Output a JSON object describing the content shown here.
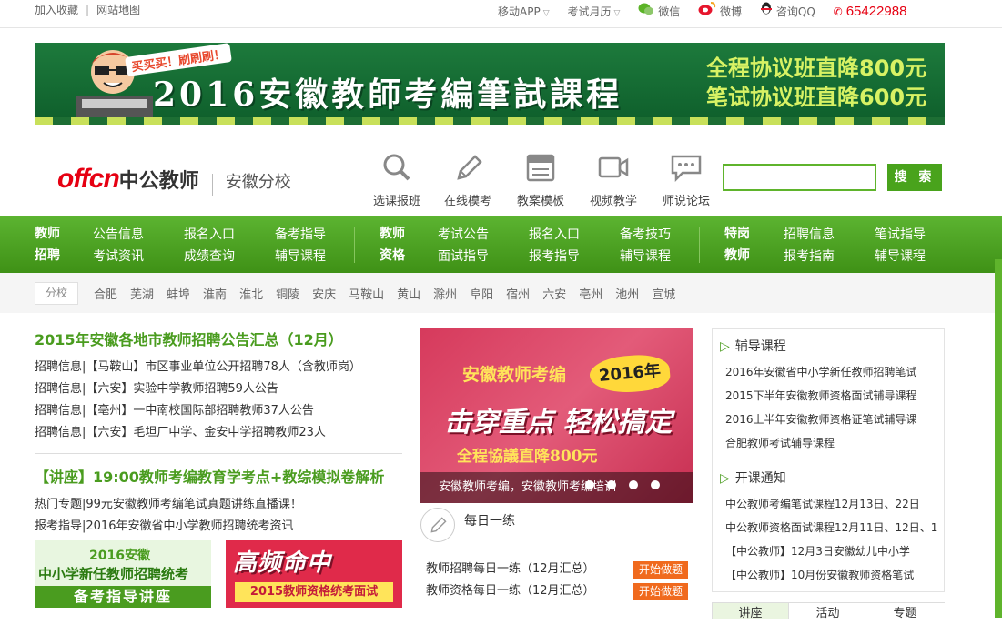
{
  "topbar": {
    "favorite": "加入收藏",
    "sitemap": "网站地图",
    "mobile_app": "移动APP",
    "exam_calendar": "考试月历",
    "wechat": "微信",
    "weibo": "微博",
    "qq": "咨询QQ",
    "phone": "65422988"
  },
  "banner": {
    "bubble": "买买买！刷刷刷！",
    "title": "2016安徽教師考編筆試課程",
    "promo_1": "全程协议班直降800元",
    "promo_2": "笔试协议班直降600元"
  },
  "brand": {
    "logo": "offcn",
    "name": "中公教师",
    "branch": "安徽分校"
  },
  "quick_links": [
    {
      "label": "选课报班",
      "icon": "search-icon"
    },
    {
      "label": "在线模考",
      "icon": "pencil-icon"
    },
    {
      "label": "教案模板",
      "icon": "calendar-icon"
    },
    {
      "label": "视频教学",
      "icon": "video-camera-icon"
    },
    {
      "label": "师说论坛",
      "icon": "chat-bubble-icon"
    }
  ],
  "search": {
    "button": "搜 索",
    "placeholder": ""
  },
  "nav": {
    "g1": {
      "title1": "教师",
      "title2": "招聘",
      "items": [
        "公告信息",
        "报名入口",
        "备考指导",
        "考试资讯",
        "成绩查询",
        "辅导课程"
      ]
    },
    "g2": {
      "title1": "教师",
      "title2": "资格",
      "items": [
        "考试公告",
        "报名入口",
        "备考技巧",
        "面试指导",
        "报考指导",
        "辅导课程"
      ]
    },
    "g3": {
      "title1": "特岗",
      "title2": "教师",
      "items": [
        "招聘信息",
        "笔试指导",
        "报考指南",
        "辅导课程"
      ]
    }
  },
  "cities": {
    "tag": "分校",
    "list": [
      "合肥",
      "芜湖",
      "蚌埠",
      "淮南",
      "淮北",
      "铜陵",
      "安庆",
      "马鞍山",
      "黄山",
      "滁州",
      "阜阳",
      "宿州",
      "六安",
      "亳州",
      "池州",
      "宣城"
    ]
  },
  "news": {
    "headline": "2015年安徽各地市教师招聘公告汇总（12月）",
    "items": [
      "招聘信息|【马鞍山】市区事业单位公开招聘78人（含教师岗）",
      "招聘信息|【六安】实验中学教师招聘59人公告",
      "招聘信息|【亳州】一中南校国际部招聘教师37人公告",
      "招聘信息|【六安】毛坦厂中学、金安中学招聘教师23人"
    ],
    "headline2": "【讲座】19:00教师考编教育学考点+教综模拟卷解析",
    "items2": [
      "热门专题|99元安徽教师考编笔试真题讲练直播课！",
      "报考指导|2016年安徽省中小学教师招聘统考资讯"
    ]
  },
  "promo_images": {
    "p1_line1": "2016安徽",
    "p1_line2": "中小学新任教师招聘统考",
    "p1_line3": "备考指导讲座",
    "p2_line1": "高频命中",
    "p2_line2": "2015教师资格统考面试"
  },
  "slide": {
    "t1": "安徽教师考编",
    "t2": "2016年",
    "t3": "击穿重点 轻松搞定",
    "t4": "全程協議直降800元",
    "caption": "安徽教师考编，安徽教师考编培训"
  },
  "daily": {
    "title": "每日一练",
    "rows": [
      {
        "text": "教师招聘每日一练（12月汇总）",
        "btn": "开始做题"
      },
      {
        "text": "教师资格每日一练（12月汇总）",
        "btn": "开始做题"
      }
    ]
  },
  "courses": {
    "title": "辅导课程",
    "items": [
      "2016年安徽省中小学新任教师招聘笔试",
      "2015下半年安徽教师资格面试辅导课程",
      "2016上半年安徽教师资格证笔试辅导课",
      "合肥教师考试辅导课程"
    ]
  },
  "openings": {
    "title": "开课通知",
    "items": [
      "中公教师考编笔试课程12月13日、22日",
      "中公教师资格面试课程12月11日、12日、1",
      "【中公教师】12月3日安徽幼儿中小学",
      "【中公教师】10月份安徽教师资格笔试"
    ]
  },
  "tabs": [
    "讲座",
    "活动",
    "专题"
  ],
  "colors": {
    "brand_green": "#4a9c1f",
    "brand_red": "#e60012",
    "button_orange": "#f06a1e"
  }
}
